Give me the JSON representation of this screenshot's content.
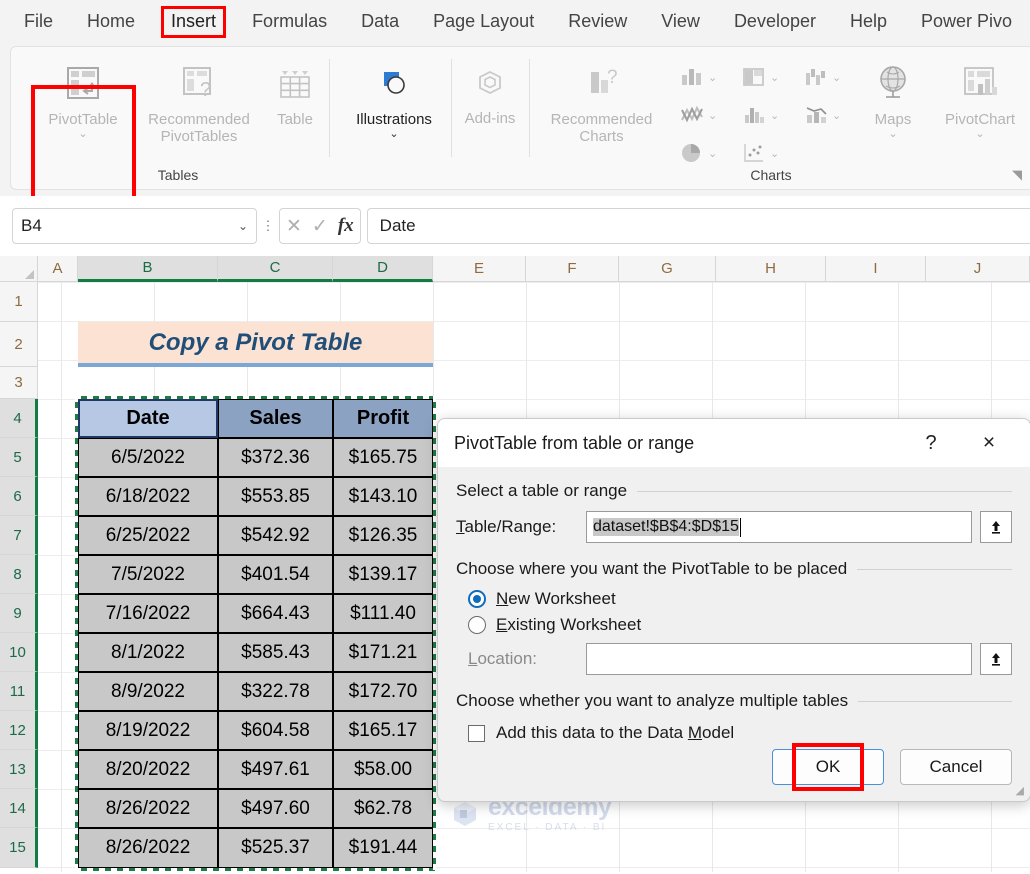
{
  "ribbon": {
    "tabs": [
      {
        "label": "File",
        "selected": false
      },
      {
        "label": "Home",
        "selected": false
      },
      {
        "label": "Insert",
        "selected": true
      },
      {
        "label": "Formulas",
        "selected": false
      },
      {
        "label": "Data",
        "selected": false
      },
      {
        "label": "Page Layout",
        "selected": false
      },
      {
        "label": "Review",
        "selected": false
      },
      {
        "label": "View",
        "selected": false
      },
      {
        "label": "Developer",
        "selected": false
      },
      {
        "label": "Help",
        "selected": false
      },
      {
        "label": "Power Pivo",
        "selected": false
      }
    ],
    "groups": {
      "tables": {
        "label": "Tables",
        "pivot_table": "PivotTable",
        "recommended_pivot_tables": "Recommended PivotTables",
        "table": "Table"
      },
      "illustrations": {
        "label": "Illustrations"
      },
      "addins": {
        "label": "Add-ins"
      },
      "charts": {
        "label": "Charts",
        "recommended_charts": "Recommended Charts",
        "maps": "Maps",
        "pivot_chart": "PivotChart"
      }
    }
  },
  "formula_bar": {
    "name_box": "B4",
    "formula_value": "Date",
    "cancel_icon": "close-icon",
    "confirm_icon": "check-icon",
    "fx_label": "fx"
  },
  "sheet": {
    "column_headers": [
      "A",
      "B",
      "C",
      "D",
      "E",
      "F",
      "G",
      "H",
      "I",
      "J"
    ],
    "selected_columns": [
      "B",
      "C",
      "D"
    ],
    "row_headers": [
      "1",
      "2",
      "3",
      "4",
      "5",
      "6",
      "7",
      "8",
      "9",
      "10",
      "11",
      "12",
      "13",
      "14",
      "15"
    ],
    "selected_rows": [
      "4",
      "5",
      "6",
      "7",
      "8",
      "9",
      "10",
      "11",
      "12",
      "13",
      "14",
      "15"
    ],
    "title_banner": "Copy a Pivot Table",
    "table": {
      "headers": [
        "Date",
        "Sales",
        "Profit"
      ],
      "rows": [
        [
          "6/5/2022",
          "$372.36",
          "$165.75"
        ],
        [
          "6/18/2022",
          "$553.85",
          "$143.10"
        ],
        [
          "6/25/2022",
          "$542.92",
          "$126.35"
        ],
        [
          "7/5/2022",
          "$401.54",
          "$139.17"
        ],
        [
          "7/16/2022",
          "$664.43",
          "$111.40"
        ],
        [
          "8/1/2022",
          "$585.43",
          "$171.21"
        ],
        [
          "8/9/2022",
          "$322.78",
          "$172.70"
        ],
        [
          "8/19/2022",
          "$604.58",
          "$165.17"
        ],
        [
          "8/20/2022",
          "$497.61",
          "$58.00"
        ],
        [
          "8/26/2022",
          "$497.60",
          "$62.78"
        ],
        [
          "8/26/2022",
          "$525.37",
          "$191.44"
        ]
      ]
    }
  },
  "watermark": {
    "name": "exceldemy",
    "tagline": "EXCEL · DATA · BI"
  },
  "dialog": {
    "title": "PivotTable from table or range",
    "help_icon": "?",
    "close_icon": "×",
    "section_range_label": "Select a table or range",
    "table_range_label": "Table/Range:",
    "table_range_value": "dataset!$B$4:$D$15",
    "section_place_label": "Choose where you want the PivotTable to be placed",
    "new_worksheet_label": "New Worksheet",
    "existing_worksheet_label": "Existing Worksheet",
    "placement_selected": "New Worksheet",
    "location_label": "Location:",
    "location_value": "",
    "section_multiple_label": "Choose whether you want to analyze multiple tables",
    "data_model_label": "Add this data to the Data Model",
    "data_model_checked": false,
    "ok_label": "OK",
    "cancel_label": "Cancel"
  },
  "colors": {
    "accent_red": "#ff0000",
    "selection_green": "#1f7a45",
    "active_blue": "#0f6cbd",
    "banner_bg": "#fbe2d3",
    "banner_text": "#1f4e79",
    "table_header_bg": "#8ba2c2",
    "table_body_bg": "#c8c8c8"
  }
}
